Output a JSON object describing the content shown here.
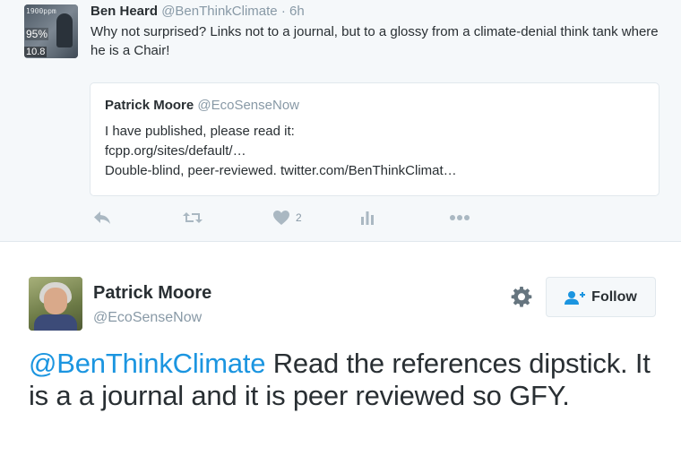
{
  "parent_tweet": {
    "author_name": "Ben Heard",
    "author_handle": "@BenThinkClimate",
    "separator": "·",
    "time": "6h",
    "avatar_text": {
      "top": "1900ppm",
      "percent": "95%",
      "number": "10.8"
    },
    "text": "Why not surprised? Links not to a journal, but to a glossy from a climate-denial think tank where he is a Chair!",
    "quoted": {
      "author_name": "Patrick Moore",
      "author_handle": "@EcoSenseNow",
      "lines": [
        "I have published, please read it:",
        "fcpp.org/sites/default/…",
        "Double-blind, peer-reviewed. twitter.com/BenThinkClimat…"
      ]
    },
    "actions": {
      "like_count": "2"
    }
  },
  "main_tweet": {
    "author_name": "Patrick Moore",
    "author_handle": "@EcoSenseNow",
    "follow_label": "Follow",
    "mention": "@BenThinkClimate",
    "text": " Read the references dipstick. It is a a journal and it is peer reviewed so GFY."
  },
  "icons": {
    "reply": "reply-icon",
    "retweet": "retweet-icon",
    "like": "heart-icon",
    "stats": "analytics-icon",
    "more": "more-icon",
    "settings": "gear-icon",
    "follow": "add-user-icon"
  },
  "colors": {
    "link": "#1b95e0",
    "muted": "#8899a6",
    "action_icon": "#aab8c2",
    "parent_background": "#f5f8fa"
  }
}
